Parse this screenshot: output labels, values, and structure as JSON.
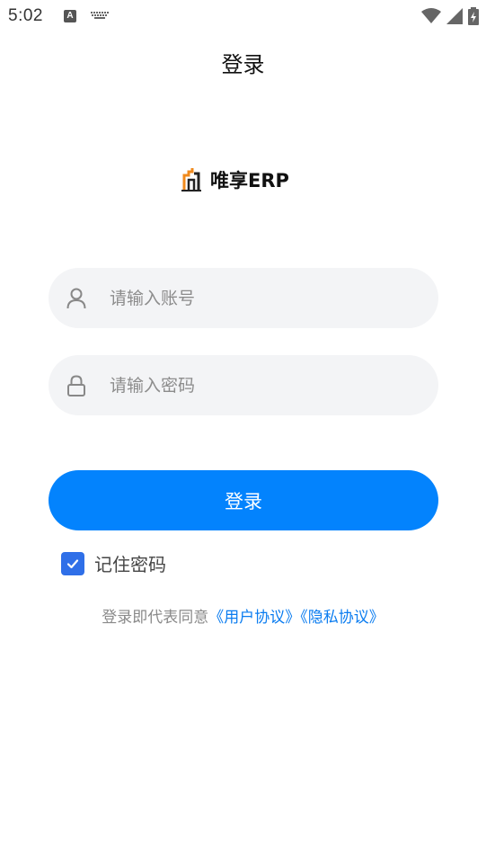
{
  "status_bar": {
    "time": "5:02",
    "a_glyph": "A"
  },
  "nav": {
    "title": "登录"
  },
  "logo": {
    "text": "唯享ERP"
  },
  "form": {
    "account": {
      "placeholder": "请输入账号",
      "value": ""
    },
    "password": {
      "placeholder": "请输入密码",
      "value": ""
    },
    "login_label": "登录",
    "remember_label": "记住密码",
    "remember_checked": true
  },
  "agreement": {
    "prefix": "登录即代表同意",
    "user_agreement": "《用户协议》",
    "privacy_agreement": "《隐私协议》"
  },
  "colors": {
    "primary": "#0383fd",
    "checkbox": "#2f6fe8",
    "link": "#0a7cf0",
    "input_bg": "#f3f4f6"
  }
}
